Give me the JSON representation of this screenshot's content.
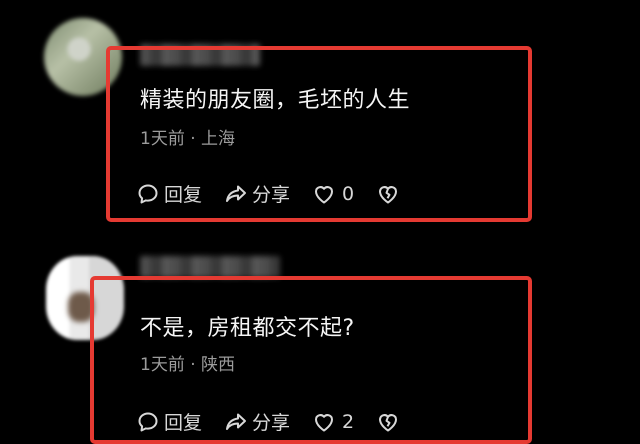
{
  "comments": [
    {
      "text": "精装的朋友圈，毛坯的人生",
      "meta": "1天前 · 上海",
      "actions": {
        "reply": "回复",
        "share": "分享",
        "likes": "0"
      }
    },
    {
      "text": "不是，房租都交不起?",
      "meta": "1天前 · 陕西",
      "actions": {
        "reply": "回复",
        "share": "分享",
        "likes": "2"
      }
    }
  ],
  "icons": {
    "reply": "speech-bubble-icon",
    "share": "share-arrow-icon",
    "like": "heart-icon",
    "dislike": "broken-heart-icon"
  },
  "colors": {
    "background": "#000000",
    "highlight": "#e53a32",
    "meta": "#9c9c9c"
  }
}
